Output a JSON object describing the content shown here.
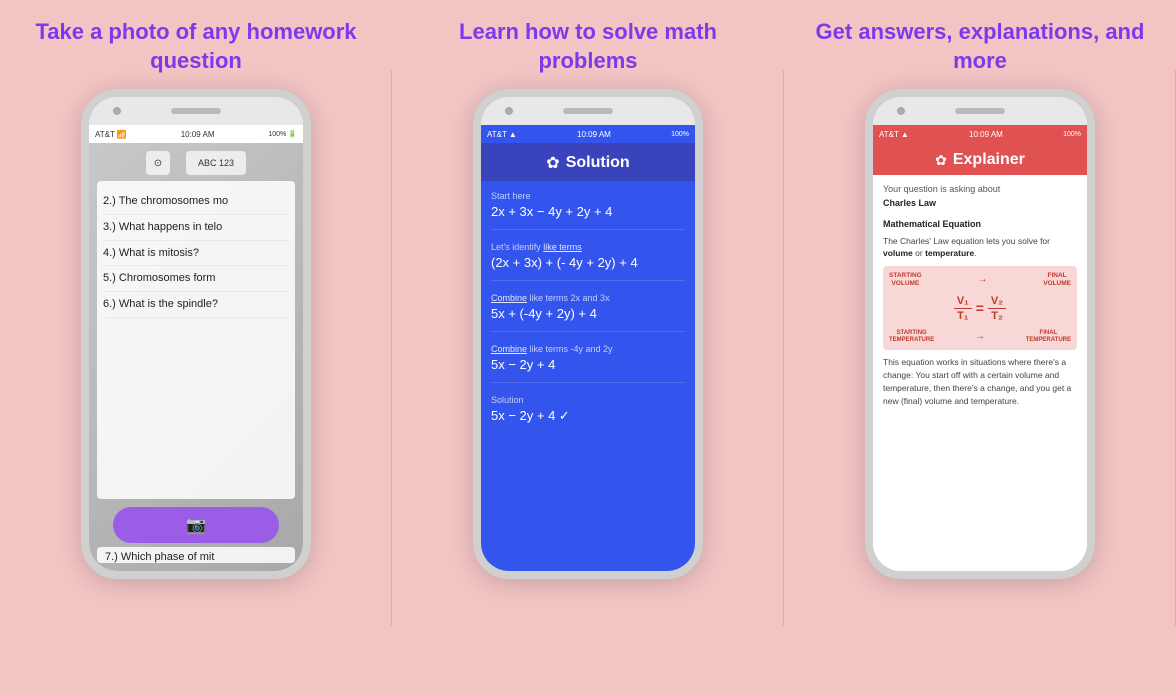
{
  "sections": [
    {
      "id": "section1",
      "title": "Take a photo of any homework question",
      "title_color": "#7c3aed",
      "phone": {
        "status": {
          "carrier": "AT&T",
          "wifi": "WiFi",
          "time": "10:09 AM",
          "battery": "100%"
        },
        "screen_type": "camera",
        "camera_toolbar": [
          "⊙",
          "ABC  123"
        ],
        "lines": [
          "2.) The chromosomes mo",
          "3.) What happens in telo",
          "4.) What is mitosis?",
          "5.) Chromosomes form",
          "6.) What is the spindle?",
          "7.) Which phase of mit"
        ],
        "capture_button_icon": "📷"
      }
    },
    {
      "id": "section2",
      "title": "Learn how to solve math problems",
      "title_color": "#7c3aed",
      "phone": {
        "status": {
          "carrier": "AT&T",
          "wifi": "WiFi",
          "time": "10:09 AM",
          "battery": "100%"
        },
        "screen_type": "solution",
        "header": "Solution",
        "steps": [
          {
            "label": "Start here",
            "formula": "2x + 3x − 4y + 2y + 4"
          },
          {
            "label": "Let's identify like terms",
            "formula": "(2x + 3x) + (- 4y + 2y) + 4"
          },
          {
            "label": "Combine like terms 2x and 3x",
            "formula": "5x + (-4y + 2y) + 4"
          },
          {
            "label": "Combine like terms -4y and 2y",
            "formula": "5x − 2y + 4"
          },
          {
            "label": "Solution",
            "formula": "5x − 2y + 4  ✓"
          }
        ]
      }
    },
    {
      "id": "section3",
      "title": "Get answers, explanations, and more",
      "title_color": "#7c3aed",
      "phone": {
        "status": {
          "carrier": "AT&T",
          "wifi": "WiFi",
          "time": "10:09 AM",
          "battery": "100%"
        },
        "screen_type": "explainer",
        "header": "Explainer",
        "subject_intro": "Your question is asking about",
        "subject_name": "Charles Law",
        "section_title": "Mathematical Equation",
        "section_desc1": "The Charles' Law equation lets you solve for",
        "section_desc1_bold1": "volume",
        "section_desc1_middle": "or",
        "section_desc1_bold2": "temperature",
        "diagram": {
          "top_left": "STARTING VOLUME",
          "top_right": "FINAL VOLUME",
          "num1": "V₁",
          "den1": "T₁",
          "num2": "V₂",
          "den2": "T₂",
          "bottom_left": "STARTING TEMPERATURE",
          "bottom_right": "FINAL TEMPERATURE"
        },
        "section_desc2": "This equation works in situations where there's a change: You start off with a certain volume and temperature, then there's a change, and you get a new (final) volume and temperature."
      }
    }
  ]
}
